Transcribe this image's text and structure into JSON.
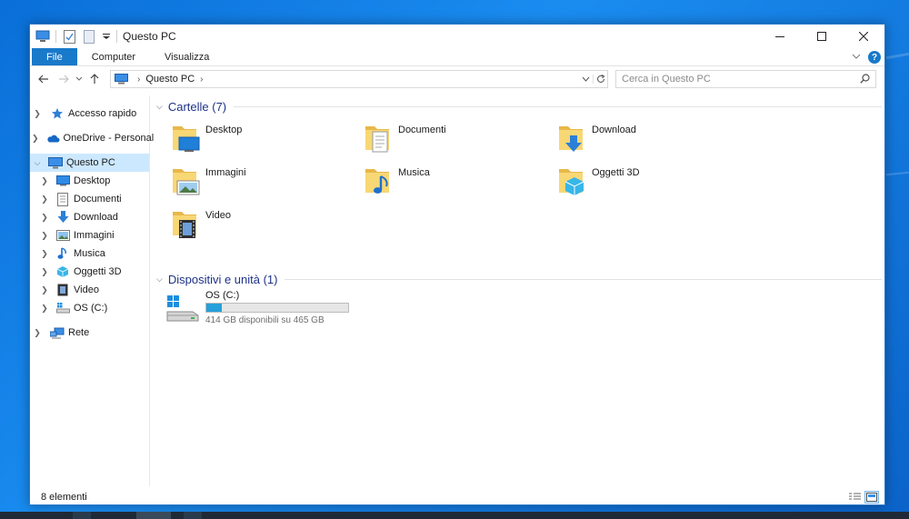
{
  "window": {
    "title": "Questo PC"
  },
  "ribbon": {
    "tabs": [
      {
        "label": "File"
      },
      {
        "label": "Computer"
      },
      {
        "label": "Visualizza"
      }
    ]
  },
  "navbar": {
    "address": {
      "crumbs": [
        "Questo PC"
      ]
    },
    "search": {
      "placeholder": "Cerca in Questo PC"
    }
  },
  "sidebar": {
    "items": [
      {
        "label": "Accesso rapido",
        "icon": "star-icon"
      },
      {
        "label": "OneDrive - Personal",
        "icon": "cloud-icon"
      },
      {
        "label": "Questo PC",
        "icon": "pc-icon",
        "selected": true
      },
      {
        "label": "Desktop",
        "icon": "desktop-icon"
      },
      {
        "label": "Documenti",
        "icon": "documents-icon"
      },
      {
        "label": "Download",
        "icon": "download-icon"
      },
      {
        "label": "Immagini",
        "icon": "pictures-icon"
      },
      {
        "label": "Musica",
        "icon": "music-icon"
      },
      {
        "label": "Oggetti 3D",
        "icon": "objects3d-icon"
      },
      {
        "label": "Video",
        "icon": "video-icon"
      },
      {
        "label": "OS (C:)",
        "icon": "drive-icon"
      },
      {
        "label": "Rete",
        "icon": "network-icon"
      }
    ]
  },
  "content": {
    "folders_header": "Cartelle (7)",
    "folders": [
      {
        "label": "Desktop",
        "icon": "desktop-folder-icon"
      },
      {
        "label": "Documenti",
        "icon": "documents-folder-icon"
      },
      {
        "label": "Download",
        "icon": "download-folder-icon"
      },
      {
        "label": "Immagini",
        "icon": "pictures-folder-icon"
      },
      {
        "label": "Musica",
        "icon": "music-folder-icon"
      },
      {
        "label": "Oggetti 3D",
        "icon": "objects3d-folder-icon"
      },
      {
        "label": "Video",
        "icon": "video-folder-icon"
      }
    ],
    "devices_header": "Dispositivi e unità (1)",
    "drives": [
      {
        "label": "OS (C:)",
        "free_text": "414 GB disponibili su 465 GB",
        "used_fraction": 0.11
      }
    ]
  },
  "statusbar": {
    "count": "8 elementi"
  },
  "colors": {
    "accent": "#1979ca",
    "selected": "#cce8ff",
    "group_header": "#1e3287",
    "drive_fill": "#26a0da",
    "folder": "#f8d775"
  }
}
